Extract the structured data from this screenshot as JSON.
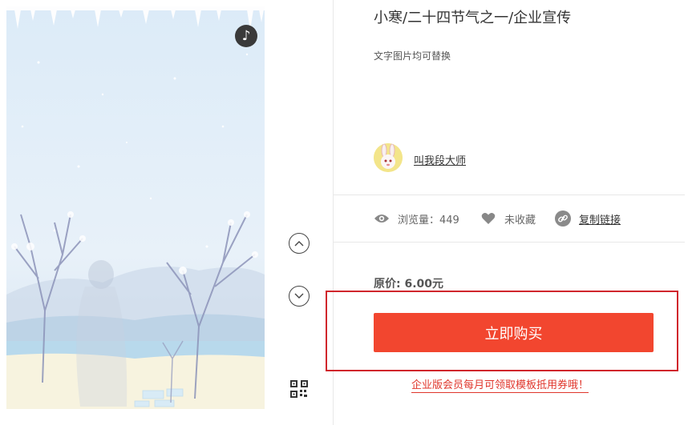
{
  "preview": {
    "music_icon": "music-note-icon",
    "music_glyph": "♪"
  },
  "controls": {
    "prev_icon": "chevron-up-icon",
    "next_icon": "chevron-down-icon",
    "qr_icon": "qr-code-icon"
  },
  "product": {
    "title": "小寒/二十四节气之一/企业宣传",
    "subtitle": "文字图片均可替换",
    "author": "叫我段大师"
  },
  "stats": {
    "views_label": "浏览量：449",
    "favorite_label": "未收藏",
    "copy_link_label": "复制链接"
  },
  "purchase": {
    "price_label": "原价: 6.00元",
    "buy_label": "立即购买",
    "promo_text": "企业版会员每月可领取模板抵用券哦！"
  },
  "colors": {
    "buy_button": "#f2462f",
    "highlight_frame": "#d0262c",
    "promo_text": "#e0362c"
  }
}
